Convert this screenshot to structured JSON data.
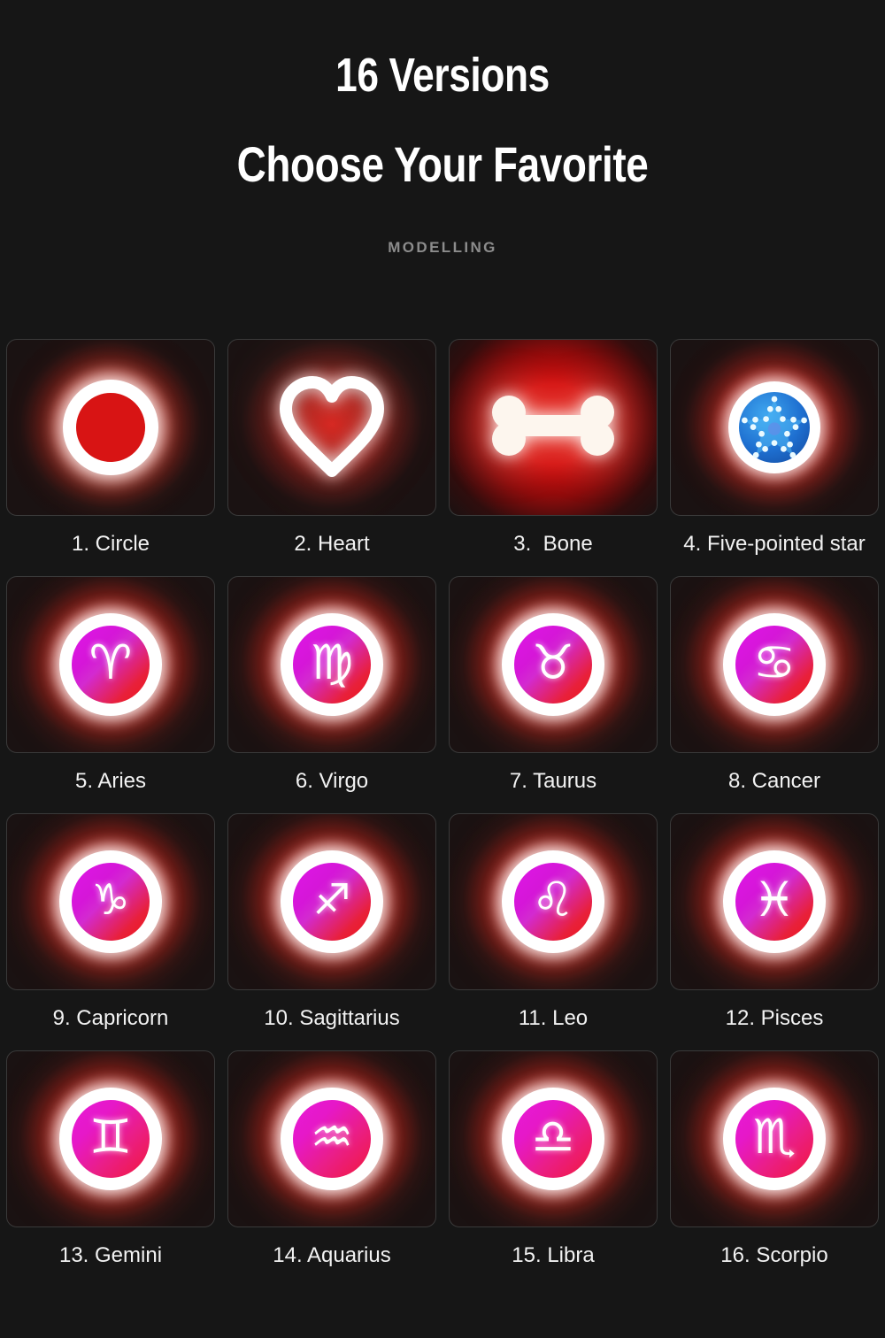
{
  "header": {
    "title_line1": "16 Versions",
    "title_line2": "Choose Your Favorite",
    "subtitle": "MODELLING"
  },
  "colors": {
    "background": "#161616",
    "glow_red": "#d61616",
    "bright_red": "#e21010",
    "badge_white": "#ffffff",
    "badge_magenta": "#e016e8",
    "badge_pink": "#e81ad8",
    "badge_red": "#f01818",
    "star_blue": "#1e6fd0",
    "label_text": "#f2f2f2",
    "subtitle_text": "#8c8c8c",
    "tile_border": "#3a3a3a"
  },
  "grid": {
    "columns": 4,
    "rows": 4,
    "items": [
      {
        "number": "1.",
        "name": "Circle",
        "label": "1. Circle",
        "icon": "circle-ring-icon",
        "style": "circle"
      },
      {
        "number": "2.",
        "name": "Heart",
        "label": "2. Heart",
        "icon": "heart-outline-icon",
        "style": "heart"
      },
      {
        "number": "3.",
        "name": "Bone",
        "label": "3.  Bone",
        "icon": "bone-icon",
        "style": "bone"
      },
      {
        "number": "4.",
        "name": "Five-pointed star",
        "label": "4. Five-pointed star",
        "icon": "five-pointed-star-icon",
        "style": "star"
      },
      {
        "number": "5.",
        "name": "Aries",
        "label": "5. Aries",
        "icon": "aries-zodiac-icon",
        "style": "zodiac",
        "glyph": "♈"
      },
      {
        "number": "6.",
        "name": "Virgo",
        "label": "6. Virgo",
        "icon": "virgo-zodiac-icon",
        "style": "zodiac",
        "glyph": "♍"
      },
      {
        "number": "7.",
        "name": "Taurus",
        "label": "7. Taurus",
        "icon": "taurus-zodiac-icon",
        "style": "zodiac",
        "glyph": "♉"
      },
      {
        "number": "8.",
        "name": "Cancer",
        "label": "8. Cancer",
        "icon": "cancer-zodiac-icon",
        "style": "zodiac",
        "glyph": "♋"
      },
      {
        "number": "9.",
        "name": "Capricorn",
        "label": "9. Capricorn",
        "icon": "capricorn-zodiac-icon",
        "style": "zodiac",
        "glyph": "♑"
      },
      {
        "number": "10.",
        "name": "Sagittarius",
        "label": "10. Sagittarius",
        "icon": "sagittarius-zodiac-icon",
        "style": "zodiac",
        "glyph": "♐"
      },
      {
        "number": "11.",
        "name": "Leo",
        "label": "11. Leo",
        "icon": "leo-zodiac-icon",
        "style": "zodiac",
        "glyph": "♌"
      },
      {
        "number": "12.",
        "name": "Pisces",
        "label": "12. Pisces",
        "icon": "pisces-zodiac-icon",
        "style": "zodiac",
        "glyph": "♓"
      },
      {
        "number": "13.",
        "name": "Gemini",
        "label": "13. Gemini",
        "icon": "gemini-zodiac-icon",
        "style": "zodiac-pink",
        "glyph": "♊"
      },
      {
        "number": "14.",
        "name": "Aquarius",
        "label": "14. Aquarius",
        "icon": "aquarius-zodiac-icon",
        "style": "zodiac-pink",
        "glyph": "♒"
      },
      {
        "number": "15.",
        "name": "Libra",
        "label": "15. Libra",
        "icon": "libra-zodiac-icon",
        "style": "zodiac-pink",
        "glyph": "♎"
      },
      {
        "number": "16.",
        "name": "Scorpio",
        "label": "16. Scorpio",
        "icon": "scorpio-zodiac-icon",
        "style": "zodiac-pink",
        "glyph": "♏"
      }
    ]
  }
}
